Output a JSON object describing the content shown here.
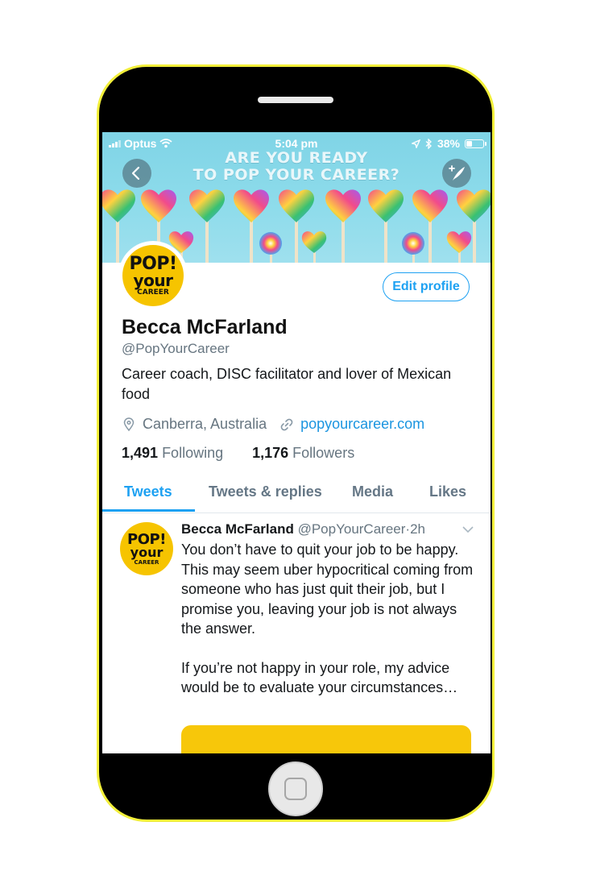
{
  "status_bar": {
    "carrier": "Optus",
    "time": "5:04 pm",
    "battery": "38%"
  },
  "banner": {
    "line1": "ARE YOU READY",
    "line2": "TO POP YOUR CAREER?"
  },
  "avatar": {
    "line1": "POP!",
    "line2": "your",
    "line3": "CAREER"
  },
  "profile": {
    "edit_button": "Edit profile",
    "name": "Becca McFarland",
    "handle": "@PopYourCareer",
    "bio": "Career coach, DISC facilitator and lover of Mexican food",
    "location": "Canberra, Australia",
    "website": "popyourcareer.com",
    "following_count": "1,491",
    "following_label": "Following",
    "followers_count": "1,176",
    "followers_label": "Followers"
  },
  "tabs": [
    {
      "label": "Tweets",
      "active": true
    },
    {
      "label": "Tweets & replies",
      "active": false
    },
    {
      "label": "Media",
      "active": false
    },
    {
      "label": "Likes",
      "active": false
    }
  ],
  "tweet": {
    "name": "Becca McFarland",
    "handle": "@PopYourCareer",
    "separator": "·",
    "age": "2h",
    "paragraph1": "You don’t have to quit your job to be happy. This may seem uber hypocritical coming from someone who has just quit their job, but I promise you, leaving your job is not always the answer.",
    "paragraph2": "If you’re not happy in your role, my advice would be to evaluate your circumstances…"
  },
  "colors": {
    "accent": "#1da1f2",
    "avatar_yellow": "#f6c400",
    "phone_border": "#f2ef3a",
    "banner_sky": "#8fdceb"
  },
  "icons": [
    "back-arrow-icon",
    "compose-icon",
    "location-pin-icon",
    "link-icon",
    "chevron-down-icon",
    "wifi-icon",
    "location-arrow-icon",
    "bluetooth-icon",
    "battery-icon",
    "signal-bars-icon"
  ]
}
